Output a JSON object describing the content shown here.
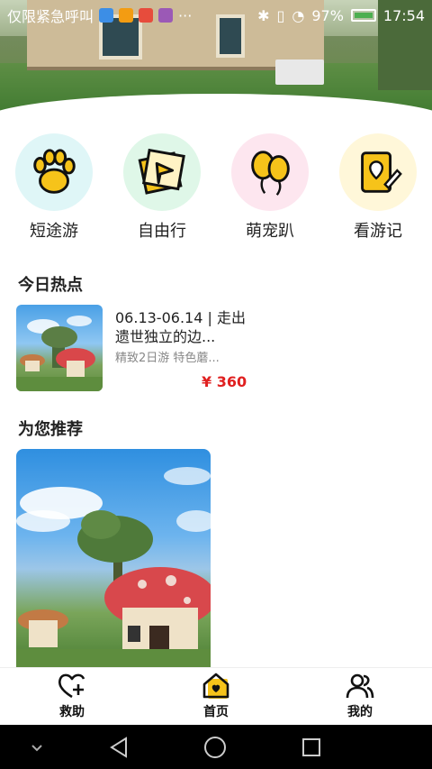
{
  "status_bar": {
    "left_text": "仅限紧急呼叫",
    "ellipsis": "···",
    "battery": "97%",
    "time": "17:54"
  },
  "categories": [
    {
      "label": "短途游",
      "icon": "paw-icon",
      "bg": "#dff6f7"
    },
    {
      "label": "自由行",
      "icon": "paper-plane-card-icon",
      "bg": "#dff7e8"
    },
    {
      "label": "萌宠趴",
      "icon": "balloons-icon",
      "bg": "#fde6ef"
    },
    {
      "label": "看游记",
      "icon": "notebook-location-icon",
      "bg": "#fff7d9"
    }
  ],
  "sections": {
    "hot_title": "今日热点",
    "recommend_title": "为您推荐"
  },
  "hot_item": {
    "title": "06.13-06.14 | 走出遗世独立的边...",
    "subtitle": "精致2日游 特色蘑...",
    "price": "¥ 360"
  },
  "bottom_nav": [
    {
      "label": "救助",
      "icon": "heart-plus-icon"
    },
    {
      "label": "首页",
      "icon": "home-heart-icon",
      "active": true
    },
    {
      "label": "我的",
      "icon": "users-icon"
    }
  ],
  "colors": {
    "accent": "#f6c31a",
    "price": "#e02020"
  }
}
